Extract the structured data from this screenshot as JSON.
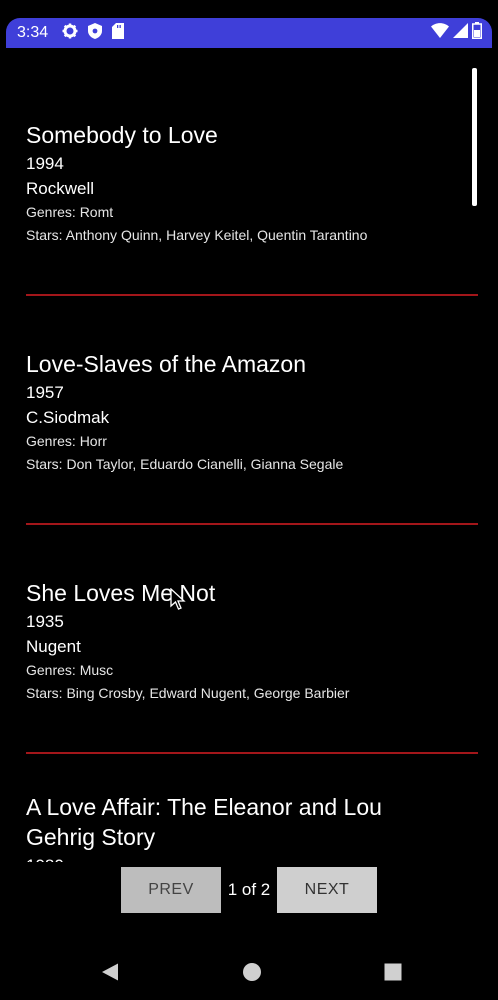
{
  "status_bar": {
    "time": "3:34",
    "icons_left": [
      "gear-icon",
      "shield-icon",
      "sd-card-icon"
    ],
    "icons_right": [
      "wifi-icon",
      "cellular-icon",
      "battery-icon"
    ],
    "color": "#3f3fd9"
  },
  "movies": [
    {
      "title": "Somebody to Love",
      "year": "1994",
      "director": "Rockwell",
      "genres": "Genres: Romt",
      "stars": "Stars: Anthony Quinn, Harvey Keitel, Quentin Tarantino"
    },
    {
      "title": "Love-Slaves of the Amazon",
      "year": "1957",
      "director": "C.Siodmak",
      "genres": "Genres: Horr",
      "stars": "Stars: Don Taylor, Eduardo Cianelli, Gianna Segale"
    },
    {
      "title": "She Loves Me Not",
      "year": "1935",
      "director": "Nugent",
      "genres": "Genres: Musc",
      "stars": "Stars: Bing Crosby, Edward Nugent, George Barbier"
    },
    {
      "title_line1": "A Love Affair: The Eleanor and Lou",
      "title_line2": "Gehrig Story",
      "year": "1980"
    }
  ],
  "divider_color": "#a3161a",
  "pager": {
    "prev_label": "PREV",
    "next_label": "NEXT",
    "page_indicator": "1 of 2"
  },
  "nav": {
    "back": "back-triangle-icon",
    "home": "home-circle-icon",
    "recents": "recents-square-icon"
  }
}
